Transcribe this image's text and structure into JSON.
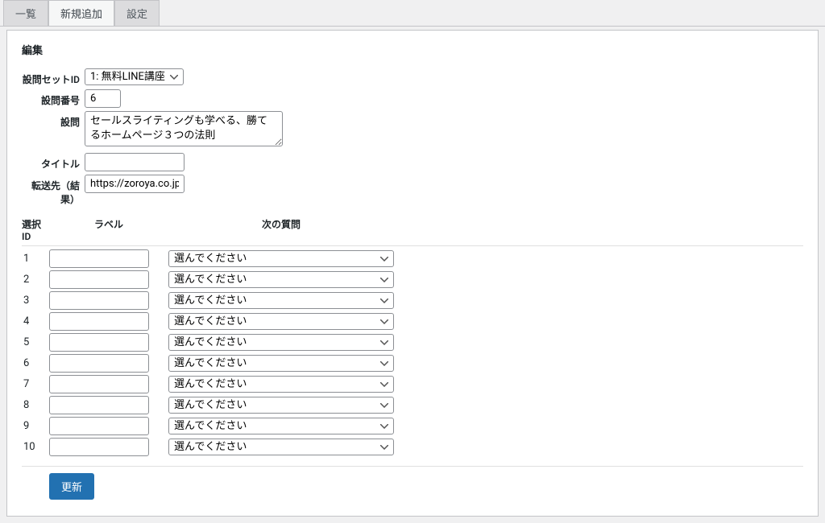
{
  "tabs": {
    "list": "一覧",
    "add": "新規追加",
    "settings": "設定"
  },
  "panel": {
    "title": "編集"
  },
  "form": {
    "setIdLabel": "設問セットID",
    "setIdValue": "1: 無料LINE講座",
    "numberLabel": "設問番号",
    "numberValue": "6",
    "questionLabel": "設問",
    "questionValue": "セールスライティングも学べる、勝てるホームページ３つの法則",
    "titleLabel": "タイトル",
    "titleValue": "",
    "redirectLabel": "転送先（結果）",
    "redirectValue": "https://zoroya.co.jp/diagn"
  },
  "choices": {
    "header": {
      "id": "選択ID",
      "label": "ラベル",
      "next": "次の質問"
    },
    "placeholder": "選んでください",
    "rows": [
      {
        "id": "1",
        "label": ""
      },
      {
        "id": "2",
        "label": ""
      },
      {
        "id": "3",
        "label": ""
      },
      {
        "id": "4",
        "label": ""
      },
      {
        "id": "5",
        "label": ""
      },
      {
        "id": "6",
        "label": ""
      },
      {
        "id": "7",
        "label": ""
      },
      {
        "id": "8",
        "label": ""
      },
      {
        "id": "9",
        "label": ""
      },
      {
        "id": "10",
        "label": ""
      }
    ]
  },
  "actions": {
    "update": "更新"
  }
}
